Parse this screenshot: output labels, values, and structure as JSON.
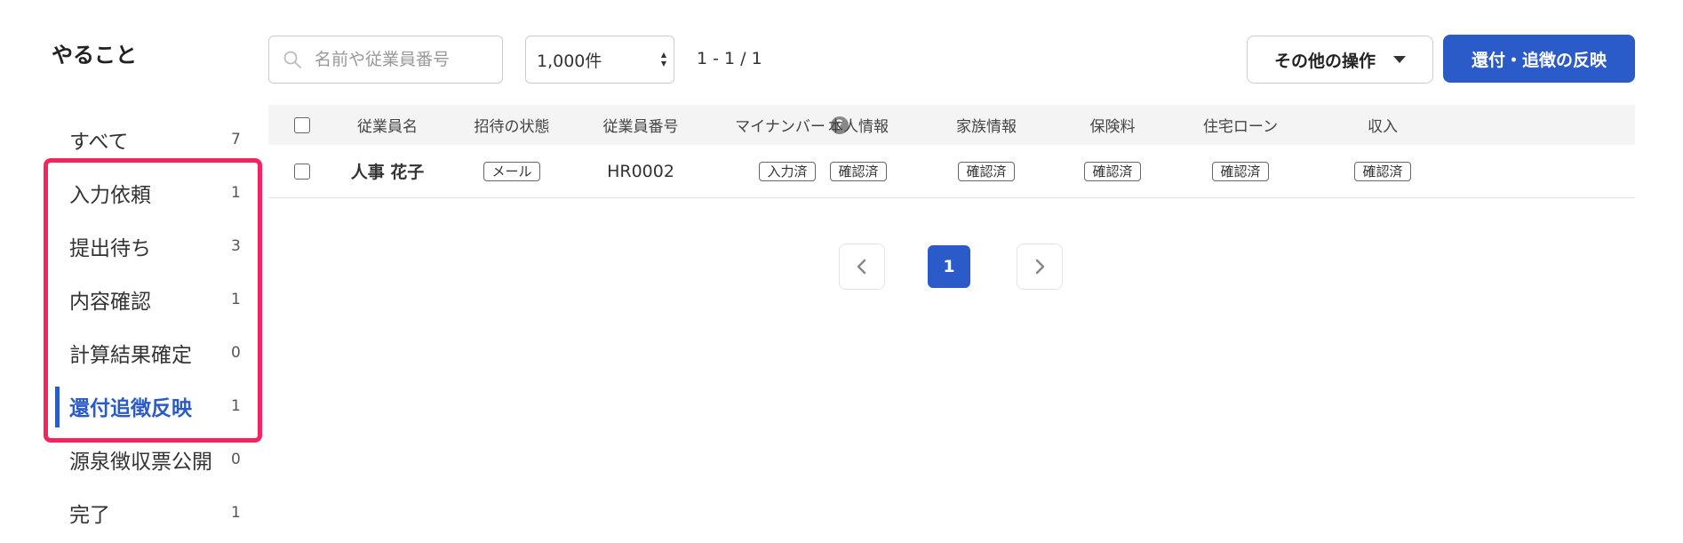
{
  "sidebar": {
    "title": "やること",
    "items": [
      {
        "label": "すべて",
        "count": "7"
      },
      {
        "label": "入力依頼",
        "count": "1"
      },
      {
        "label": "提出待ち",
        "count": "3"
      },
      {
        "label": "内容確認",
        "count": "1"
      },
      {
        "label": "計算結果確定",
        "count": "0"
      },
      {
        "label": "還付追徴反映",
        "count": "1"
      },
      {
        "label": "源泉徴収票公開",
        "count": "0"
      },
      {
        "label": "完了",
        "count": "1"
      }
    ],
    "active_item": "還付追徴反映"
  },
  "toolbar": {
    "search_placeholder": "名前や従業員番号",
    "per_page": "1,000件",
    "range": "1 - 1 / 1",
    "other_actions_label": "その他の操作",
    "apply_label": "還付・追徴の反映"
  },
  "table": {
    "headers": {
      "name": "従業員名",
      "invite": "招待の状態",
      "number": "従業員番号",
      "mynumber": "マイナンバー",
      "personal": "本人情報",
      "family": "家族情報",
      "insurance": "保険料",
      "loan": "住宅ローン",
      "income": "収入"
    },
    "rows": [
      {
        "name": "人事 花子",
        "invite": "メール",
        "number": "HR0002",
        "mynumber": "入力済",
        "personal": "確認済",
        "family": "確認済",
        "insurance": "確認済",
        "loan": "確認済",
        "income": "確認済"
      }
    ]
  },
  "pagination": {
    "current_page": "1"
  },
  "colors": {
    "accent": "#2b5bc9",
    "highlight": "#f5235e"
  }
}
